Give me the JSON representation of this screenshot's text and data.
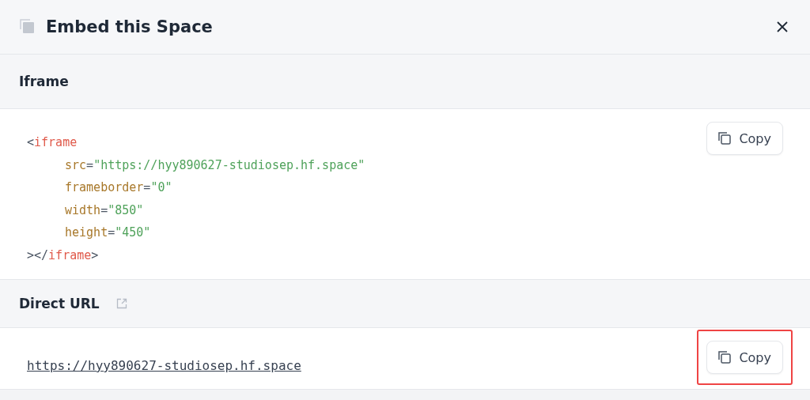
{
  "dialog": {
    "title": "Embed this Space"
  },
  "sections": [
    {
      "heading": "Iframe",
      "kind": "code",
      "code_lines": [
        {
          "indented": false,
          "tokens": [
            {
              "kind": "punct",
              "text": "<"
            },
            {
              "kind": "tag",
              "text": "iframe"
            }
          ]
        },
        {
          "indented": true,
          "tokens": [
            {
              "kind": "attr",
              "text": "src"
            },
            {
              "kind": "punct",
              "text": "="
            },
            {
              "kind": "string",
              "text": "\"https://hyy890627-studiosep.hf.space\""
            }
          ]
        },
        {
          "indented": true,
          "tokens": [
            {
              "kind": "attr",
              "text": "frameborder"
            },
            {
              "kind": "punct",
              "text": "="
            },
            {
              "kind": "string",
              "text": "\"0\""
            }
          ]
        },
        {
          "indented": true,
          "tokens": [
            {
              "kind": "attr",
              "text": "width"
            },
            {
              "kind": "punct",
              "text": "="
            },
            {
              "kind": "string",
              "text": "\"850\""
            }
          ]
        },
        {
          "indented": true,
          "tokens": [
            {
              "kind": "attr",
              "text": "height"
            },
            {
              "kind": "punct",
              "text": "="
            },
            {
              "kind": "string",
              "text": "\"450\""
            }
          ]
        },
        {
          "indented": false,
          "tokens": [
            {
              "kind": "punct",
              "text": "></"
            },
            {
              "kind": "tag",
              "text": "iframe"
            },
            {
              "kind": "punct",
              "text": ">"
            }
          ]
        }
      ],
      "copy": {
        "label": "Copy",
        "highlighted": false
      }
    },
    {
      "heading": "Direct URL",
      "kind": "link",
      "url": "https://hyy890627-studiosep.hf.space",
      "copy": {
        "label": "Copy",
        "highlighted": true
      }
    }
  ]
}
